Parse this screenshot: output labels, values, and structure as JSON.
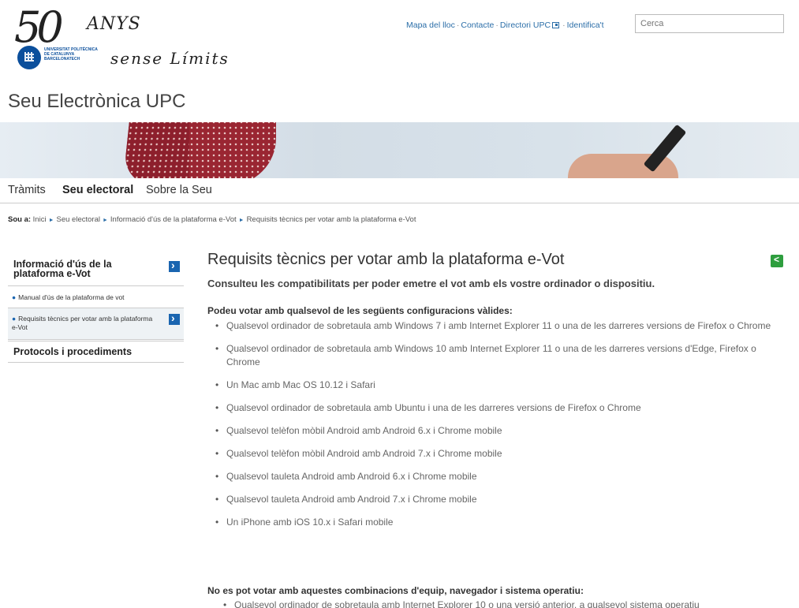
{
  "logo": {
    "big": "50",
    "anys": "ANYS",
    "university": "UNIVERSITAT POLITÈCNICA\nDE CATALUNYA\nBARCELONATECH",
    "tagline": "sense Límits"
  },
  "toplinks": {
    "site_map": "Mapa del lloc",
    "contact": "Contacte",
    "directory": "Directori UPC",
    "login": "Identifica't"
  },
  "search": {
    "placeholder": "Cerca"
  },
  "site_title": "Seu Electrònica UPC",
  "nav": {
    "items": [
      "Tràmits",
      "Seu electoral",
      "Sobre la Seu"
    ]
  },
  "breadcrumb": {
    "prefix": "Sou a:",
    "items": [
      "Inici",
      "Seu electoral",
      "Informació d'ús de la plataforma e-Vot",
      "Requisits tècnics per votar amb la plataforma e-Vot"
    ]
  },
  "sidebar": {
    "section1": "Informació d'ús de la plataforma e-Vot",
    "item1": "Manual d'ús de la plataforma de vot",
    "item2": "Requisits tècnics per votar amb la plataforma e-Vot",
    "section2": "Protocols i procediments"
  },
  "main": {
    "title": "Requisits tècnics per votar amb la plataforma e-Vot",
    "lead": "Consulteu les compatibilitats per poder emetre el vot amb els vostre ordinador o dispositiu.",
    "valid_heading": "Podeu votar amb qualsevol de les següents configuracions vàlides:",
    "valid": [
      "Qualsevol ordinador de sobretaula amb Windows 7 i amb Internet Explorer 11 o una de les darreres versions de Firefox o Chrome",
      "Qualsevol ordinador de sobretaula amb Windows 10 amb Internet Explorer 11 o una de les darreres versions d'Edge, Firefox o Chrome",
      "Un Mac amb Mac OS 10.12 i Safari",
      "Qualsevol ordinador de sobretaula amb Ubuntu i una de les darreres versions de Firefox o Chrome",
      "Qualsevol telèfon mòbil Android amb Android 6.x i Chrome mobile",
      "Qualsevol telèfon mòbil Android amb Android 7.x i Chrome mobile",
      "Qualsevol tauleta Android amb Android 6.x i Chrome mobile",
      "Qualsevol tauleta Android amb Android 7.x i Chrome mobile",
      "Un iPhone amb iOS 10.x i Safari mobile"
    ],
    "invalid_heading": "No es pot votar amb aquestes combinacions d'equip, navegador i sistema operatiu:",
    "invalid_first": "Qualsevol ordinador de sobretaula amb Internet Explorer 10 o una versió anterior, a qualsevol sistema operatiu"
  }
}
